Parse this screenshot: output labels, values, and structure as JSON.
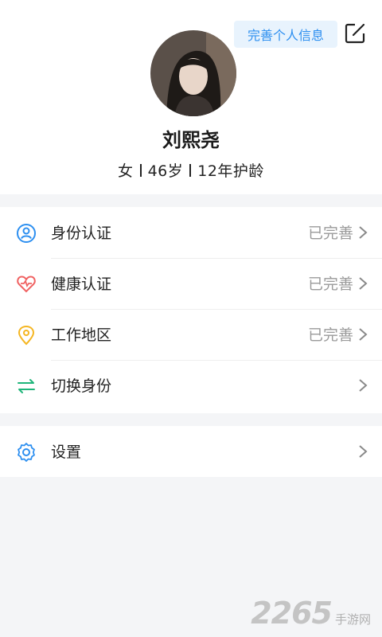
{
  "profile": {
    "complete_label": "完善个人信息",
    "name": "刘熙尧",
    "gender": "女",
    "age": "46岁",
    "experience": "12年护龄"
  },
  "menu": [
    {
      "label": "身份认证",
      "status": "已完善",
      "icon": "id-card-icon",
      "color": "#2d8ff0"
    },
    {
      "label": "健康认证",
      "status": "已完善",
      "icon": "heart-pulse-icon",
      "color": "#f06262"
    },
    {
      "label": "工作地区",
      "status": "已完善",
      "icon": "location-pin-icon",
      "color": "#f5b622"
    },
    {
      "label": "切换身份",
      "status": "",
      "icon": "switch-arrows-icon",
      "color": "#1fb57a"
    }
  ],
  "settings": {
    "label": "设置",
    "icon": "gear-icon",
    "color": "#2d8ff0"
  },
  "watermark": {
    "number": "2265",
    "text": "手游网"
  }
}
